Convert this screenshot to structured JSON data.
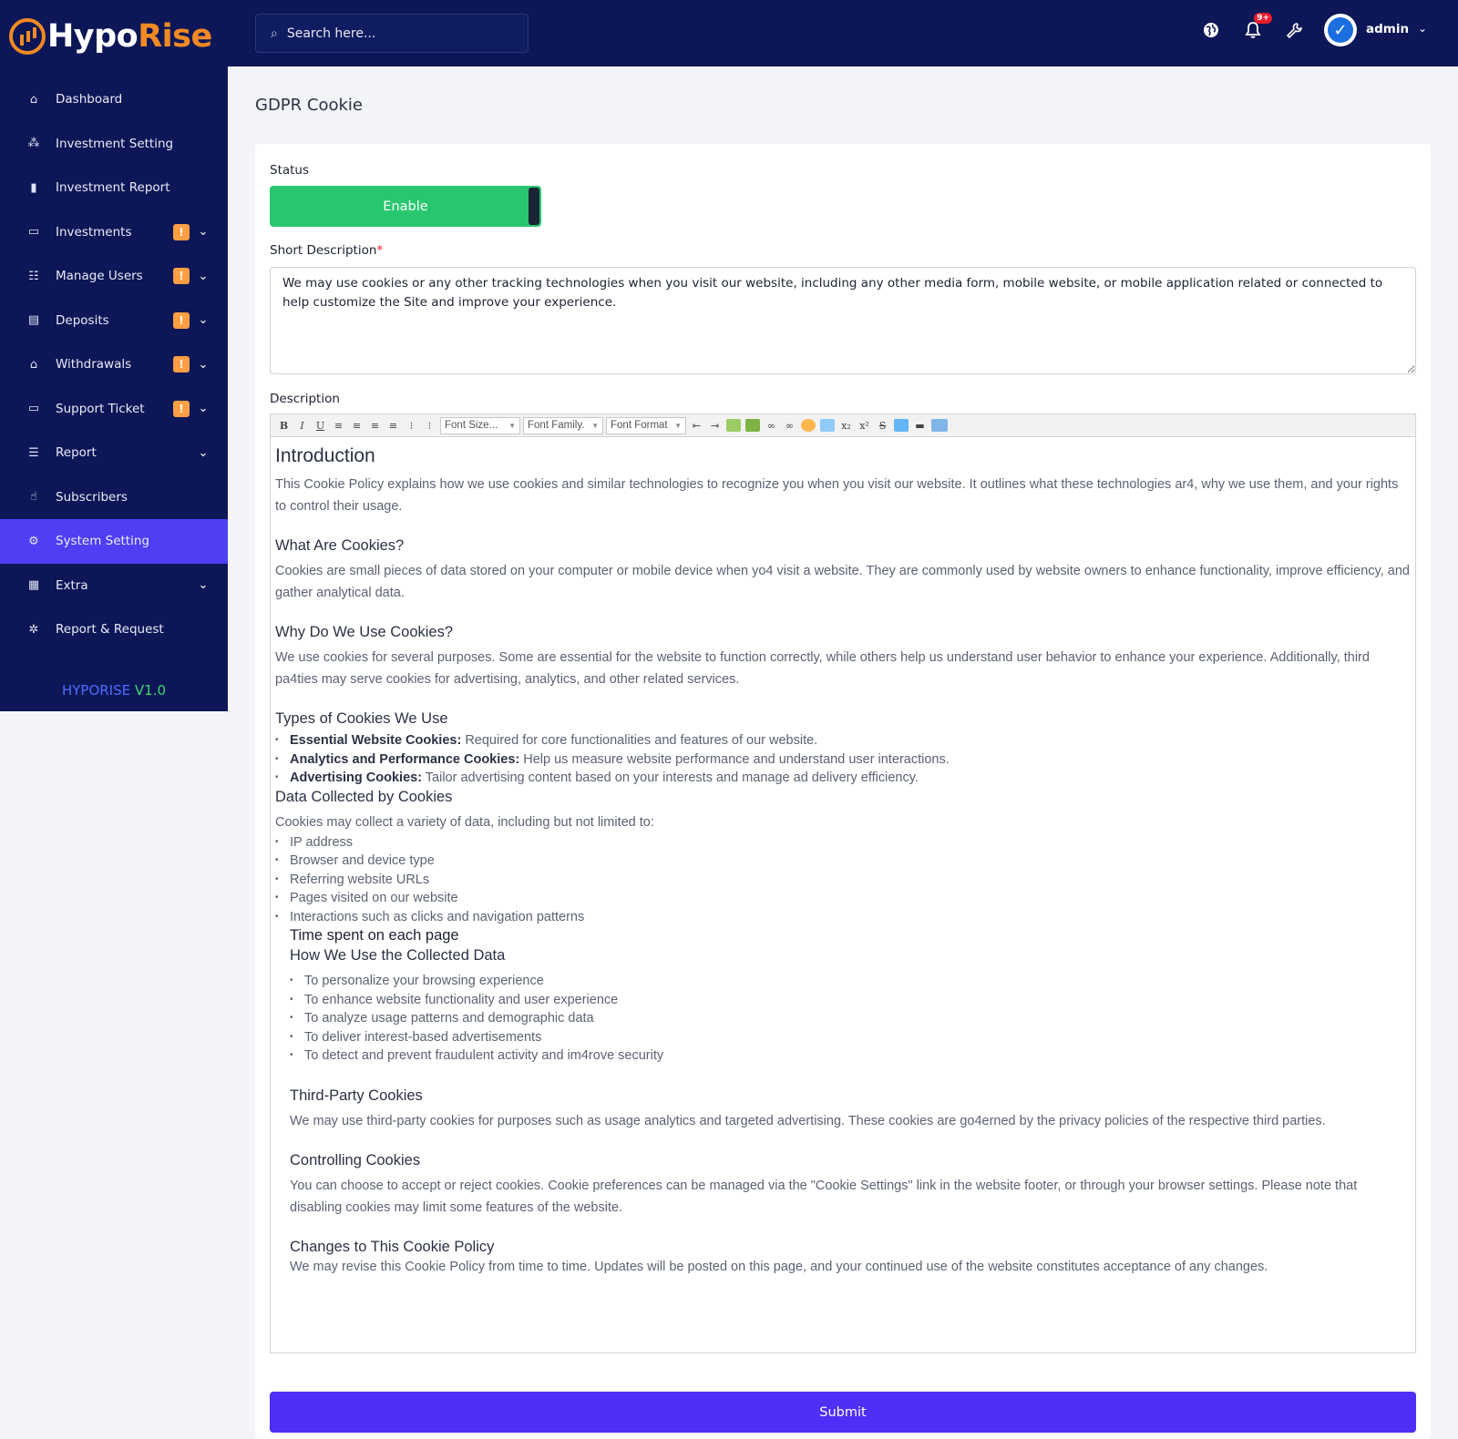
{
  "brand": {
    "part1": "Hypo",
    "part2": "Rise"
  },
  "sidebar": {
    "items": [
      {
        "label": "Dashboard",
        "icon": "home-icon",
        "badge": "",
        "chevron": false
      },
      {
        "label": "Investment Setting",
        "icon": "cubes-icon",
        "badge": "",
        "chevron": false
      },
      {
        "label": "Investment Report",
        "icon": "bar-chart-icon",
        "badge": "",
        "chevron": false
      },
      {
        "label": "Investments",
        "icon": "wallet-icon",
        "badge": "!",
        "chevron": true
      },
      {
        "label": "Manage Users",
        "icon": "users-icon",
        "badge": "!",
        "chevron": true
      },
      {
        "label": "Deposits",
        "icon": "invoice-icon",
        "badge": "!",
        "chevron": true
      },
      {
        "label": "Withdrawals",
        "icon": "bank-icon",
        "badge": "!",
        "chevron": true
      },
      {
        "label": "Support Ticket",
        "icon": "ticket-icon",
        "badge": "!",
        "chevron": true
      },
      {
        "label": "Report",
        "icon": "list-icon",
        "badge": "",
        "chevron": true
      },
      {
        "label": "Subscribers",
        "icon": "thumbs-up-icon",
        "badge": "",
        "chevron": false
      },
      {
        "label": "System Setting",
        "icon": "gear-icon",
        "badge": "",
        "chevron": false,
        "active": true
      },
      {
        "label": "Extra",
        "icon": "table-icon",
        "badge": "",
        "chevron": true
      },
      {
        "label": "Report & Request",
        "icon": "bug-icon",
        "badge": "",
        "chevron": false
      }
    ],
    "version_name": "HYPORISE",
    "version_number": "V1.0"
  },
  "header": {
    "search_placeholder": "Search here...",
    "notification_count": "9+",
    "user_name": "admin"
  },
  "page": {
    "title": "GDPR Cookie",
    "status_label": "Status",
    "status_value": "Enable",
    "short_description_label": "Short Description",
    "required_mark": "*",
    "short_description_value": "We may use cookies or any other tracking technologies when you visit our website, including any other media form, mobile website, or mobile application related or connected to help customize the Site and improve your experience.",
    "description_label": "Description",
    "submit_label": "Submit"
  },
  "editor": {
    "font_size_placeholder": "Font Size...",
    "font_family_placeholder": "Font Family.",
    "font_format_placeholder": "Font Format",
    "content": {
      "intro_heading": "Introduction",
      "intro_text": "This Cookie Policy explains how we use cookies and similar technologies to recognize you when you visit our website. It outlines what these technologies ar4, why we use them, and your rights to control their usage.",
      "what_heading": "What Are Cookies?",
      "what_text": "Cookies are small pieces of data stored on your computer or mobile device when yo4 visit a website. They are commonly used by website owners to enhance functionality, improve efficiency, and gather analytical data.",
      "why_heading": "Why Do We Use Cookies?",
      "why_text": "We use cookies for several purposes. Some are essential for the website to function correctly, while others help us understand user behavior to enhance your experience. Additionally, third pa4ties may serve cookies for advertising, analytics, and other related services.",
      "types_heading": "Types of Cookies We Use",
      "types": [
        {
          "bold": "Essential Website Cookies:",
          "text": " Required for core functionalities and features of our website."
        },
        {
          "bold": "Analytics and Performance Cookies:",
          "text": " Help us measure website performance and understand user interactions."
        },
        {
          "bold": "Advertising Cookies:",
          "text": " Tailor advertising content based on your interests and manage ad delivery efficiency."
        }
      ],
      "data_heading": "Data Collected by Cookies",
      "data_text": "Cookies may collect a variety of data, including but not limited to:",
      "data_items": [
        "IP address",
        "Browser and device type",
        "Referring website URLs",
        "Pages visited on our website",
        "Interactions such as clicks and navigation patterns"
      ],
      "time_spent": "Time spent on each page",
      "use_heading": "How We Use the Collected Data",
      "use_items": [
        "To personalize your browsing experience",
        "To enhance website functionality and user experience",
        "To analyze usage patterns and demographic data",
        "To deliver interest-based advertisements",
        "To detect and prevent fraudulent activity and im4rove security"
      ],
      "third_heading": "Third-Party Cookies",
      "third_text": "We may use third-party cookies for purposes such as usage analytics and targeted advertising. These cookies are go4erned by the privacy policies of the respective third parties.",
      "control_heading": "Controlling Cookies",
      "control_text": "You can choose to accept or reject cookies. Cookie preferences can be managed via the \"Cookie Settings\" link in the website footer, or through your browser settings. Please note that disabling cookies may limit some features of the website.",
      "changes_heading": "Changes to This Cookie Policy",
      "changes_text": "We may revise this Cookie Policy from time to time. Updates will be posted on this page, and your continued use of the website constitutes acceptance of any changes."
    }
  },
  "colors": {
    "sidebar_bg": "#0d1757",
    "accent": "#4e2ff5",
    "enable_green": "#28c76f",
    "badge_orange": "#ff9f43",
    "brand_orange": "#f08a24"
  }
}
